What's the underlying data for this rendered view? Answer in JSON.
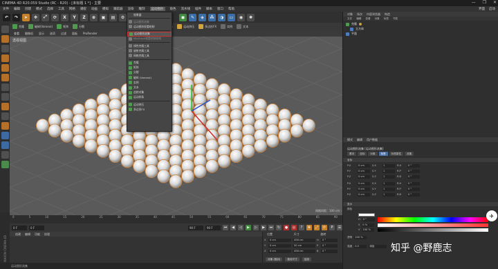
{
  "window": {
    "title": "CINEMA 4D R20.059 Studio (RC - R20) - [未标题 1 *] - 主要",
    "controls": [
      "—",
      "❐",
      "✕"
    ]
  },
  "menubar": {
    "items": [
      "文件",
      "编辑",
      "创建",
      "模式",
      "选择",
      "工具",
      "网格",
      "捕捉",
      "动画",
      "模拟",
      "跟踪器",
      "渲染",
      "雕刻",
      "运动图形",
      "角色",
      "流水线",
      "插件",
      "脚本",
      "窗口",
      "帮助"
    ],
    "active_index": 13,
    "right": [
      "界面",
      "启动"
    ]
  },
  "toolbar2": {
    "items": [
      "克隆",
      "破碎(Voronoi)",
      "矩阵",
      "分裂",
      "追踪对象",
      "运动样条",
      "运动挤压",
      "多边形FX",
      "实例",
      "文本"
    ]
  },
  "viewport": {
    "tabs": [
      "查看",
      "摄像机",
      "显示",
      "选项",
      "过滤",
      "面板",
      "ProRender"
    ],
    "title": "透视视图",
    "grid_info": "网格间距：100 cm"
  },
  "dropdown": {
    "items": [
      {
        "label": "效果器",
        "icon": "none"
      },
      {
        "label": "",
        "sep": true
      },
      {
        "label": "运动图形选集",
        "icon": "gray",
        "dim": true
      },
      {
        "label": "运动图形权重绘制",
        "icon": "gray"
      },
      {
        "label": "",
        "sep": true
      },
      {
        "label": "运动图形选集",
        "icon": "green",
        "selected": true
      },
      {
        "label": "MoGraph权重绘制画笔",
        "icon": "gray",
        "dim": true
      },
      {
        "label": "",
        "sep": true
      },
      {
        "label": "线性克隆工具",
        "icon": "gray"
      },
      {
        "label": "放射克隆工具",
        "icon": "gray"
      },
      {
        "label": "网格克隆工具",
        "icon": "gray"
      },
      {
        "label": "",
        "sep": true
      },
      {
        "label": "克隆",
        "icon": "green"
      },
      {
        "label": "矩阵",
        "icon": "green"
      },
      {
        "label": "分裂",
        "icon": "green"
      },
      {
        "label": "破碎 (Voronoi)",
        "icon": "green"
      },
      {
        "label": "实例",
        "icon": "green"
      },
      {
        "label": "文本",
        "icon": "green"
      },
      {
        "label": "追踪对象",
        "icon": "green"
      },
      {
        "label": "运动样条",
        "icon": "green"
      },
      {
        "label": "",
        "sep": true
      },
      {
        "label": "运动挤压",
        "icon": "green"
      },
      {
        "label": "多边形FX",
        "icon": "green"
      }
    ]
  },
  "timeline": {
    "ticks": [
      "0",
      "5",
      "10",
      "15",
      "20",
      "25",
      "30",
      "35",
      "40",
      "45",
      "50",
      "55",
      "60",
      "65",
      "70",
      "75",
      "80",
      "85",
      "90"
    ],
    "start": "0 F",
    "current": "0 F",
    "end": "90 F",
    "end2": "90 F"
  },
  "material_panel": {
    "tabs": [
      "创建",
      "编辑",
      "功能",
      "纹理"
    ]
  },
  "coordinates": {
    "headers": [
      "位置",
      "尺寸",
      "旋转"
    ],
    "rows": [
      {
        "axis": "X",
        "pos": "0 cm",
        "size": "456 cm",
        "rotl": "H",
        "rot": "0 °"
      },
      {
        "axis": "Y",
        "pos": "0 cm",
        "size": "50 cm",
        "rotl": "P",
        "rot": "0 °"
      },
      {
        "axis": "Z",
        "pos": "0 cm",
        "size": "456 cm",
        "rotl": "B",
        "rot": "0 °"
      }
    ],
    "mode": "对象 (相对)",
    "size_mode": "绝对尺寸",
    "apply": "应用"
  },
  "statusbar": "运动图形选集",
  "maxon_label": "MAXON CINEMA 4D",
  "object_manager": {
    "tabs": [
      "对象",
      "场次",
      "内容浏览器",
      "构造"
    ],
    "menu": [
      "文件",
      "编辑",
      "查看",
      "对象",
      "标签",
      "书签"
    ],
    "objects": [
      {
        "name": "克隆",
        "icon": "green"
      },
      {
        "name": "立方体",
        "icon": "blue"
      },
      {
        "name": "平面",
        "icon": "blue"
      }
    ]
  },
  "attributes": {
    "tabs": [
      "模式",
      "编辑",
      "用户数据"
    ],
    "menu": [
      "模式",
      "编辑",
      "用户数据"
    ],
    "name": "运动图形选集 [运动图形选集]",
    "subtabs": [
      "基本",
      "坐标",
      "对象",
      "标签",
      "标签属性",
      "选集"
    ],
    "subtab_active": 3,
    "section_coord": "坐标",
    "section_paint": "显示",
    "pos_rows": [
      {
        "l": "P.X",
        "v": "0 cm",
        "s": "S.X",
        "sv": "1",
        "r": "R.H",
        "rv": "0 °"
      },
      {
        "l": "P.Y",
        "v": "0 cm",
        "s": "S.Y",
        "sv": "1",
        "r": "R.P",
        "rv": "0 °"
      },
      {
        "l": "P.Z",
        "v": "0 cm",
        "s": "S.Z",
        "sv": "1",
        "r": "R.B",
        "rv": "0 °"
      }
    ],
    "pos_rows2": [
      {
        "l": "P.X",
        "v": "0 cm",
        "s": "S.X",
        "sv": "1",
        "r": "R.H",
        "rv": "0 °"
      },
      {
        "l": "P.Y",
        "v": "0 cm",
        "s": "S.Y",
        "sv": "1",
        "r": "R.P",
        "rv": "0 °"
      },
      {
        "l": "P.Z",
        "v": "0 cm",
        "s": "S.Z",
        "sv": "1",
        "r": "R.B",
        "rv": "0 °"
      }
    ],
    "color_label": "颜色",
    "h_label": "H",
    "h_value": "0 °",
    "s_label": "S",
    "s_value": "0 %",
    "v_label": "V",
    "v_value": "100 %",
    "opacity_label": "透明",
    "opacity_value": "100 %",
    "bottom_label": "强度",
    "bottom_value": "0.5",
    "bottom_mode": "添加"
  },
  "watermark": "知乎 @野鹿志",
  "logo_glyph": "✈",
  "colors": {
    "accent": "#4a6fa5",
    "selection_border": "#d03030",
    "object_green": "#4f9a4f"
  }
}
